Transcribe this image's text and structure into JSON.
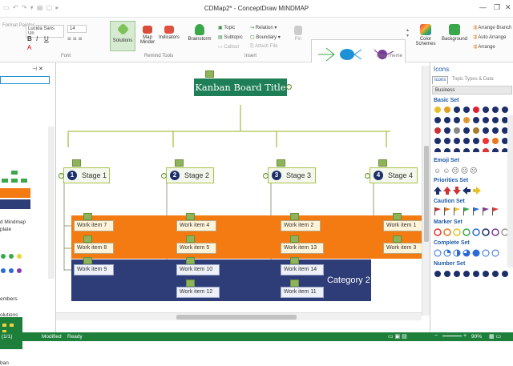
{
  "window": {
    "title": "CDMap2* - ConceptDraw MINDMAP"
  },
  "ribbon": {
    "font_name": "Lucida Sans Un",
    "font_size": "14",
    "format_painter": "Format Painter",
    "groups": {
      "font": "Font",
      "remind_tools": "Remind Tools",
      "insert": "Insert",
      "map_theme": "Map Theme"
    },
    "buttons": {
      "solutions": "Solutions",
      "map_minder": "Map Minder",
      "indicators": "Indicators",
      "brainstorm": "Brainstorm",
      "topic": "Topic",
      "relation": "Relation",
      "subtopic": "Subtopic",
      "boundary": "Boundary",
      "callout": "Callout",
      "attach_file": "Attach File",
      "pin": "Pin",
      "color_schemes": "Color Schemes",
      "background": "Background",
      "arrange_branches": "Arrange Branch",
      "auto_arrange": "Auto Arrange",
      "arrange": "Arrange"
    }
  },
  "left_panel": {
    "item1": "d Mindmap",
    "item2": "plate",
    "item3": "embers",
    "item4": "ban",
    "bottom": "olutions"
  },
  "map": {
    "title": "Kanban Board Title",
    "stages": [
      {
        "num": "1",
        "label": "Stage 1"
      },
      {
        "num": "2",
        "label": "Stage 2"
      },
      {
        "num": "3",
        "label": "Stage 3"
      },
      {
        "num": "4",
        "label": "Stage 4"
      }
    ],
    "stage1_items": [
      "Work item 7",
      "Work item 8",
      "Work item 9"
    ],
    "stage2_items": [
      "Work item 4",
      "Work item 5",
      "Work item 10",
      "Work item 12"
    ],
    "stage3_items": [
      "Work item 2",
      "Work item 13",
      "Work item 14",
      "Work item 11"
    ],
    "stage4_items": [
      "Work item 1",
      "Work item 3"
    ],
    "category2": "Category 2",
    "colors": {
      "orange": "#f47a12",
      "navy": "#2e3c78",
      "title_bg": "#1e7f57"
    }
  },
  "right_panel": {
    "title": "Icons",
    "tabs": [
      "Icons",
      "Topic Types & Data"
    ],
    "dropdown": "Business",
    "sections": [
      "Basic Set",
      "Emoji Set",
      "Priorities Set",
      "Caution Set",
      "Marker Set",
      "Complete Set",
      "Number Set"
    ]
  },
  "status": {
    "page": "(1/1)",
    "modified": "Modified",
    "ready": "Ready",
    "zoom": "90%"
  }
}
